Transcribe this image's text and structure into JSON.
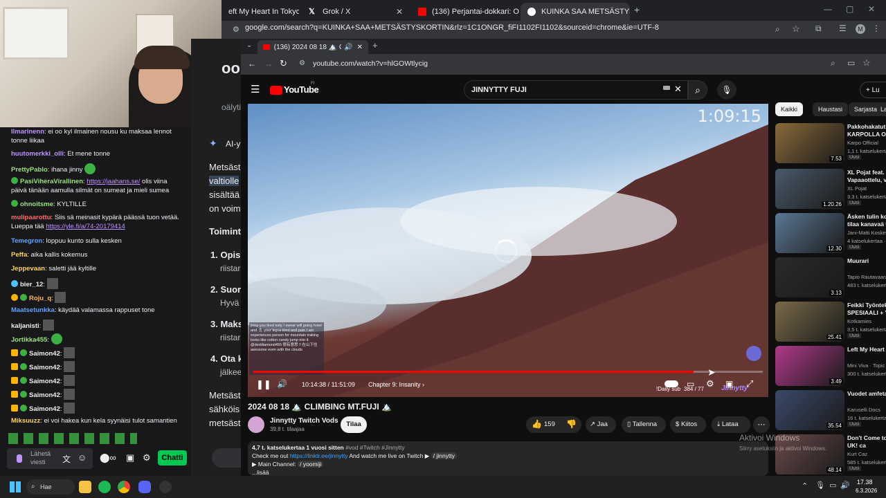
{
  "outer_browser": {
    "tabs": [
      {
        "label": "eft My Heart In Tokyo - Y",
        "icon": "youtube-icon"
      },
      {
        "label": "Grok / X",
        "icon": "x-logo-icon"
      },
      {
        "label": "(136) Perjantai-dokkari: Oispa t",
        "icon": "youtube-icon"
      },
      {
        "label": "KUINKA SAA METSÄSTYSKORTI",
        "icon": "google-icon"
      }
    ],
    "new_tab": "+",
    "url": "google.com/search?q=KUINKA+SAA+METSÄSTYSKORTIN&rlz=1C1ONGR_fiFI1102FI1102&sourceid=chrome&ie=UTF-8",
    "profile": "M"
  },
  "google_page": {
    "ai_label": "AI-y",
    "lines": [
      "Metsäst",
      "valtiolle",
      "sisältää",
      "on voim",
      "Toimint",
      "1. Opis",
      "riistar",
      "2. Suor",
      "Hyvä",
      "3. Maks",
      "riistar",
      "4. Ota k",
      "jälkeen",
      "Metsäst",
      "sähköis",
      "metsäst",
      "oälyti"
    ]
  },
  "chat": {
    "messages": [
      {
        "user": "Ilmarinenn",
        "color": "#bf94ff",
        "text": "ei oo kyl ilmainen nousu ku maksaa lennot tonne liikaa"
      },
      {
        "user": "huutomerkki_olli",
        "color": "#bf94ff",
        "text": "Et mene tonne"
      },
      {
        "user": "PrettyPablo",
        "color": "#9be37a",
        "text": "ihana jinny"
      },
      {
        "user": "PasiViheraVirallinen",
        "color": "#9be37a",
        "text": "",
        "link": "https://jaahans.se/",
        "text2": "olis viina päivä tänään aamulla silmät on sumeat ja mieli sumea"
      },
      {
        "user": "ohnoitsme",
        "color": "#9be37a",
        "text": "KYLTILLE"
      },
      {
        "user": "mulipaarottu",
        "color": "#ff6b6b",
        "text": "Siis sä meinasit kypärä päässä tuon vetää. Lueppa tää",
        "link": "https://yle.fi/a/74-20179414"
      },
      {
        "user": "Temegron",
        "color": "#5ea3ff",
        "text": "loppuu kunto sulla kesken"
      },
      {
        "user": "Peffa",
        "color": "#ffd54f",
        "text": "aika kallis kokemus"
      },
      {
        "user": "Jeppevaan",
        "color": "#ffd54f",
        "text": "saletti jää kyltille"
      },
      {
        "user": "bier_12",
        "color": "#efeff1",
        "text": ""
      },
      {
        "user": "Roju_q",
        "color": "#ffb74d",
        "text": ""
      },
      {
        "user": "Maatsetunkka",
        "color": "#5ea3ff",
        "text": "käydää valamassa rappuset tone"
      },
      {
        "user": "kaljanisti",
        "color": "#efeff1",
        "text": ""
      },
      {
        "user": "Jortikka455",
        "color": "#9be37a",
        "text": ""
      },
      {
        "user": "Saimon42",
        "color": "#efeff1",
        "text": ""
      },
      {
        "user": "Saimon42",
        "color": "#efeff1",
        "text": ""
      },
      {
        "user": "Saimon42",
        "color": "#efeff1",
        "text": ""
      },
      {
        "user": "Saimon42",
        "color": "#efeff1",
        "text": ""
      },
      {
        "user": "Saimon42",
        "color": "#efeff1",
        "text": ""
      },
      {
        "user": "Miksuuzz",
        "color": "#ffd54f",
        "text": "ei voi hakea kun kela syynäisi tulot samantien"
      }
    ],
    "input_placeholder": "Lähetä viesti",
    "send_label": "Chatti"
  },
  "inner_browser": {
    "tab_label": "(136) 2024 08 18 🏔️ CLIMB",
    "new_tab": "+",
    "url": "youtube.com/watch?v=hlGOWtlycig"
  },
  "youtube": {
    "logo": "YouTube",
    "logo_sup": "FI",
    "search_value": "JINNYTTY FUJI",
    "sign_in": "Lu",
    "filter_chips": [
      "Kaikki",
      "Haustasi",
      "Sarjasta",
      "La"
    ],
    "video": {
      "overlay_timer": "1:09:15",
      "current_time": "10:14:38",
      "duration": "11:51:09",
      "time_display": "10:14:38 / 11:51:09",
      "progress_fraction": 0.864,
      "chapter": "Chapter 9: Insanity",
      "overlay_chat_lines": [
        "jinny you tired tody I swear will going hotel and 🎗 your leg is tired and pain I am experiences person for mountain traking",
        "looks like cotton candy jump into it",
        "@deddiamond455 很有意思 ‼ 在山下住",
        "awesome even with the clouds"
      ],
      "bottom_right_text": "!Daily sub",
      "sub_count": "384 / 77",
      "watermark": "Jinnytty"
    },
    "title": "2024 08 18 🏔️ CLIMBING MT.FUJI 🏔️",
    "channel": "Jinnytty Twitch Vods",
    "subs": "39,8 t. tilaajaa",
    "subscribe": "Tilaa",
    "likes": "159",
    "actions": [
      "Jaa",
      "Tallenna",
      "Kiitos",
      "Lataa"
    ],
    "description": {
      "stats": "4,7 t. katselukertaa  1 vuosi sitten",
      "tags": "#vod #Twitch #Jinnytty",
      "line1_pre": "Check me out",
      "line1_link": "https://linktr.ee/jinnytty",
      "line1_post": "And watch me live on Twitch ▶",
      "line1_handle": "/ jinnytty",
      "line2_pre": "▶ Main Channel:",
      "line2_handle": "/ yoomiji",
      "more": "...lisää"
    },
    "recommendations": [
      {
        "title": "Pakkohakatut",
        "title2": "KARPOLLA ON",
        "channel": "Karpo Official",
        "views": "1,1 t. katselukerta",
        "new": "Uusi",
        "duration": "7.53",
        "thumb": "#8a6a3a"
      },
      {
        "title": "XL Pojat feat. A",
        "title2": "Vapaaottelu, vi",
        "channel": "XL Pojat",
        "views": "3,3 t. katselukerta",
        "new": "Uusi",
        "duration": "1.20.26",
        "thumb": "#4a5a6a"
      },
      {
        "title": "Äsken tulin kot",
        "title2": "tilaa kanavaä t",
        "channel": "Jani-Matti Koskel",
        "views": "4 katselukertaa ·",
        "new": "Uusi",
        "duration": "12.30",
        "thumb": "#5b7894"
      },
      {
        "title": "Muurari",
        "title2": "",
        "channel": "Tapio Rautavaara",
        "views": "483 t. katselukert",
        "new": "",
        "duration": "3.13",
        "thumb": "#2a2a2a"
      },
      {
        "title": "Feikki Työntekij",
        "title2": "SPESIAALI + Y",
        "channel": "Kotkamies",
        "views": "3,5 t. katselukerta",
        "new": "Uusi",
        "duration": "25.41",
        "thumb": "#7a6a4a"
      },
      {
        "title": "Left My Heart I",
        "title2": "",
        "channel": "Mini Viva · Topic",
        "views": "300 t. katselukert",
        "new": "",
        "duration": "3.49",
        "thumb": "#b03a8a"
      },
      {
        "title": "Vuodet amfeta",
        "title2": "",
        "channel": "Karuselli Docs",
        "views": "16 t. katselukerta",
        "new": "Uusi",
        "duration": "35.54",
        "thumb": "#3a4a6a"
      },
      {
        "title": "Don't Come to",
        "title2": "UK! ca",
        "channel": "Kurt Caz",
        "views": "585 t. katselukerta",
        "new": "Uusi",
        "duration": "48.14",
        "thumb": "#6a4a4a"
      }
    ]
  },
  "windows_activation": {
    "line1": "Aktivoi Windows",
    "line2": "Siirry asetuksiin ja aktivoi Windows."
  },
  "taskbar": {
    "search": "Hae",
    "time": "17.38",
    "date": "6.3.2026"
  }
}
